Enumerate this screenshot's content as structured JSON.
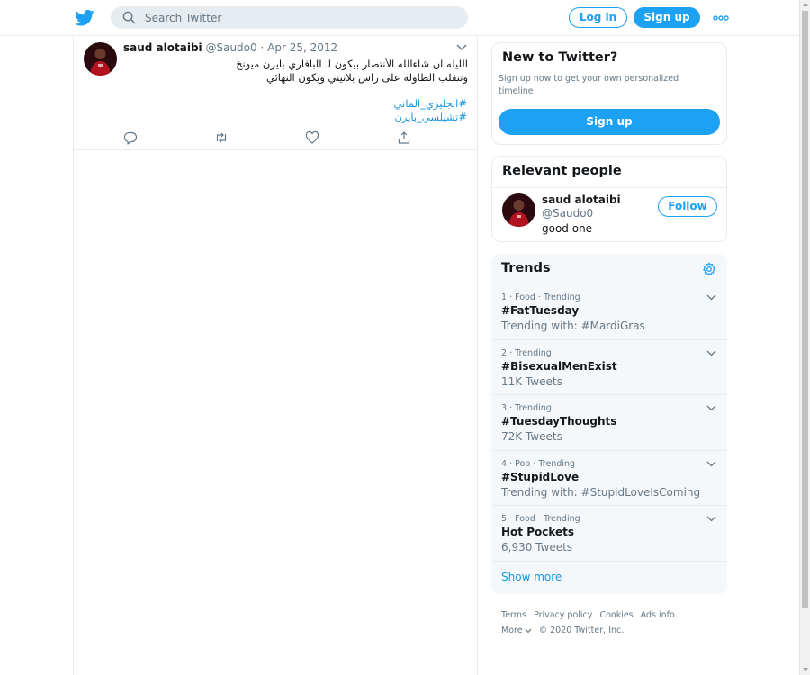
{
  "header": {
    "logo_icon": "twitter-bird-icon",
    "search_placeholder": "Search Twitter",
    "login_label": "Log in",
    "signup_label": "Sign up",
    "more_icon": "more-dots-icon"
  },
  "tweet": {
    "name": "saud alotaibi",
    "handle": "@Saudo0",
    "separator": "·",
    "date": "Apr 25, 2012",
    "text_line1": "الليله ان شاءالله الأنتصار بيكون لـ البافاري بايرن ميونخ",
    "text_line2": "وتنقلب الطاوله على راس بلانيني ويكون النهائي",
    "hashtags": [
      "#انجليزي_الماني",
      "#تشيلسي_بايرن"
    ],
    "actions": [
      "reply-icon",
      "retweet-icon",
      "like-icon",
      "share-icon"
    ]
  },
  "new_to_twitter": {
    "title": "New to Twitter?",
    "description": "Sign up now to get your own personalized timeline!",
    "signup_label": "Sign up"
  },
  "relevant_people": {
    "title": "Relevant people",
    "person": {
      "name": "saud alotaibi",
      "handle": "@Saudo0",
      "bio": "good one",
      "follow_label": "Follow"
    }
  },
  "trends": {
    "title": "Trends",
    "settings_icon": "gear-icon",
    "items": [
      {
        "meta": "1 · Food · Trending",
        "name": "#FatTuesday",
        "sub": "Trending with: #MardiGras"
      },
      {
        "meta": "2 · Trending",
        "name": "#BisexualMenExist",
        "sub": "11K Tweets"
      },
      {
        "meta": "3 · Trending",
        "name": "#TuesdayThoughts",
        "sub": "72K Tweets"
      },
      {
        "meta": "4 · Pop · Trending",
        "name": "#StupidLove",
        "sub": "Trending with: #StupidLoveIsComing"
      },
      {
        "meta": "5 · Food · Trending",
        "name": "Hot Pockets",
        "sub": "6,930 Tweets"
      }
    ],
    "show_more": "Show more"
  },
  "footer": {
    "links": [
      "Terms",
      "Privacy policy",
      "Cookies",
      "Ads info"
    ],
    "more": "More",
    "copyright": "© 2020 Twitter, Inc."
  },
  "colors": {
    "accent": "#1da1f2",
    "link": "#1b95e0",
    "border": "#e6ecf0",
    "muted": "#657786"
  }
}
